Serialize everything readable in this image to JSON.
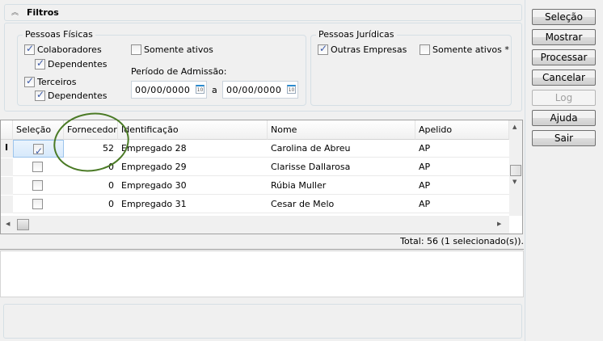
{
  "filters": {
    "title": "Filtros",
    "fisicas": {
      "title": "Pessoas Físicas",
      "colaboradores": "Colaboradores",
      "dependentes1": "Dependentes",
      "terceiros": "Terceiros",
      "dependentes2": "Dependentes",
      "somente_ativos": "Somente ativos",
      "periodo_label": "Período de Admissão:",
      "date_from": "00/00/0000",
      "date_sep": "a",
      "date_to": "00/00/0000"
    },
    "juridicas": {
      "title": "Pessoas Jurídicas",
      "outras": "Outras Empresas",
      "somente_ativos": "Somente ativos *"
    }
  },
  "buttons": [
    "Seleção",
    "Mostrar",
    "Processar",
    "Cancelar",
    "Log",
    "Ajuda",
    "Sair"
  ],
  "grid": {
    "columns": [
      "Seleção",
      "Fornecedor",
      "Identificação",
      "Nome",
      "Apelido"
    ],
    "rows": [
      {
        "selected": true,
        "fornecedor": "52",
        "identificacao": "Empregado 28",
        "nome": "Carolina de Abreu",
        "apelido": "AP"
      },
      {
        "selected": false,
        "fornecedor": "0",
        "identificacao": "Empregado 29",
        "nome": "Clarisse Dallarosa",
        "apelido": "AP"
      },
      {
        "selected": false,
        "fornecedor": "0",
        "identificacao": "Empregado 30",
        "nome": "Rúbia Muller",
        "apelido": "AP"
      },
      {
        "selected": false,
        "fornecedor": "0",
        "identificacao": "Empregado 31",
        "nome": "Cesar de Melo",
        "apelido": "AP"
      }
    ]
  },
  "status": "Total: 56 (1 selecionado(s)).",
  "colors": {
    "annotation": "#4a7a25"
  }
}
